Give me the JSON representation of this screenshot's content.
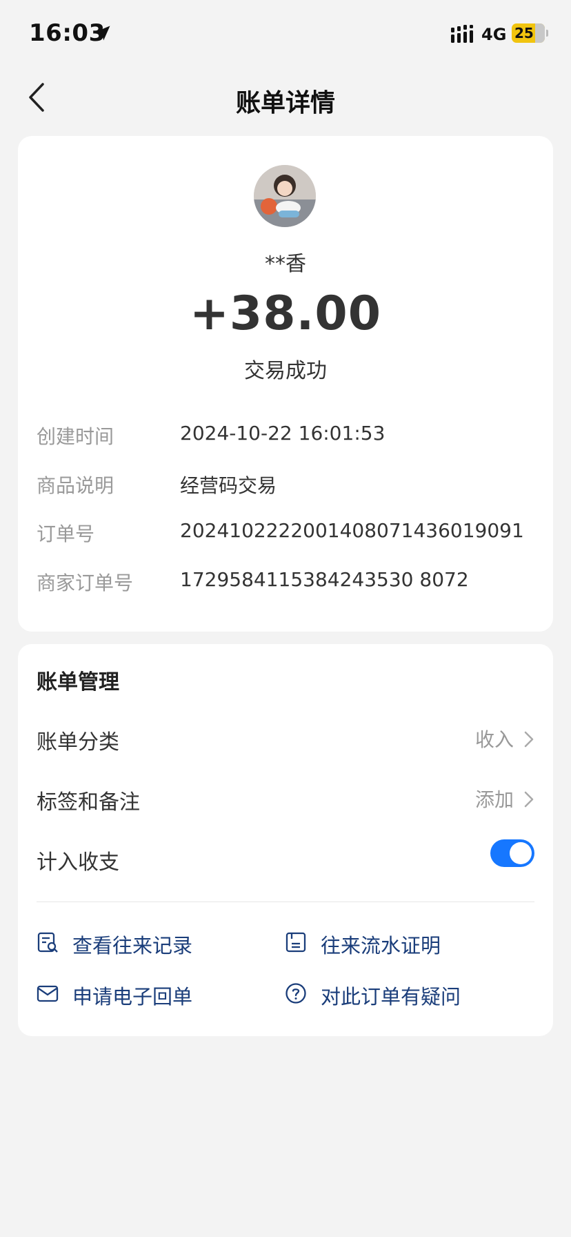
{
  "status_bar": {
    "time": "16:03",
    "network": "4G",
    "battery": "25"
  },
  "nav": {
    "title": "账单详情"
  },
  "transaction": {
    "payer_name": "**香",
    "amount": "+38.00",
    "status": "交易成功"
  },
  "details": [
    {
      "label": "创建时间",
      "value": "2024-10-22 16:01:53"
    },
    {
      "label": "商品说明",
      "value": "经营码交易"
    },
    {
      "label": "订单号",
      "value": "2024102222001408071436019091"
    },
    {
      "label": "商家订单号",
      "value": "1729584115384243530 8072"
    }
  ],
  "manage": {
    "title": "账单管理",
    "category_label": "账单分类",
    "category_value": "收入",
    "tags_label": "标签和备注",
    "tags_value": "添加",
    "include_label": "计入收支",
    "include_on": true
  },
  "links": {
    "records": "查看往来记录",
    "proof": "往来流水证明",
    "receipt": "申请电子回单",
    "question": "对此订单有疑问"
  },
  "colors": {
    "accent": "#1677ff",
    "link": "#1a3d7a",
    "background": "#f3f3f3"
  }
}
